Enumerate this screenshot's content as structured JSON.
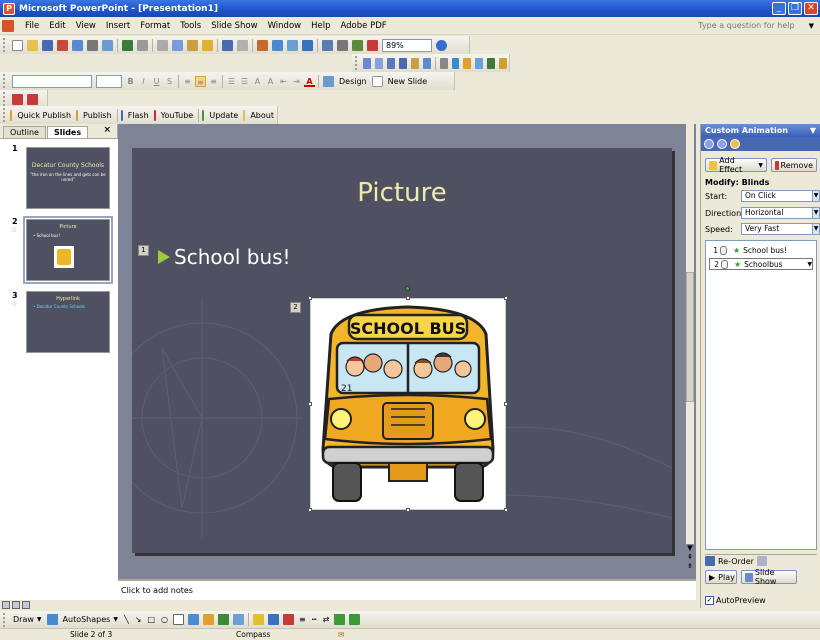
{
  "window": {
    "title": "Microsoft PowerPoint - [Presentation1]"
  },
  "menu": {
    "items": [
      "File",
      "Edit",
      "View",
      "Insert",
      "Format",
      "Tools",
      "Slide Show",
      "Window",
      "Help",
      "Adobe PDF"
    ],
    "help_placeholder": "Type a question for help"
  },
  "toolbar": {
    "zoom": "89%",
    "design_label": "Design",
    "new_slide_label": "New Slide",
    "quick_publish": "Quick Publish",
    "publish": "Publish",
    "flash": "Flash",
    "youtube": "YouTube",
    "update": "Update",
    "about": "About"
  },
  "left_panel": {
    "tabs": [
      "Outline",
      "Slides"
    ],
    "slides": [
      {
        "number": "1",
        "title": "Decatur County Schools",
        "subtitle": "\"the iron on the lines and gets can be unred\""
      },
      {
        "number": "2",
        "title": "Picture",
        "bullet": "• School bus!"
      },
      {
        "number": "3",
        "title": "Hyperlink",
        "link": "• Decatur County Schools"
      }
    ]
  },
  "slide": {
    "title": "Picture",
    "bullet": "School bus!",
    "tag_bullet": "1",
    "tag_picture": "2",
    "bus_sign": "SCHOOL BUS",
    "bus_number": "21"
  },
  "notes": {
    "placeholder": "Click to add notes"
  },
  "task_pane": {
    "title": "Custom Animation",
    "add_effect": "Add Effect",
    "remove": "Remove",
    "modify_label": "Modify: Blinds",
    "start_label": "Start:",
    "start_value": "On Click",
    "direction_label": "Direction:",
    "direction_value": "Horizontal",
    "speed_label": "Speed:",
    "speed_value": "Very Fast",
    "items": [
      {
        "num": "1",
        "name": "School bus!"
      },
      {
        "num": "2",
        "name": "Schoolbus"
      }
    ],
    "reorder": "Re-Order",
    "play": "Play",
    "slide_show": "Slide Show",
    "autopreview": "AutoPreview"
  },
  "drawing": {
    "draw": "Draw",
    "autoshapes": "AutoShapes"
  },
  "status": {
    "slide_info": "Slide 2 of 3",
    "design": "Compass"
  }
}
